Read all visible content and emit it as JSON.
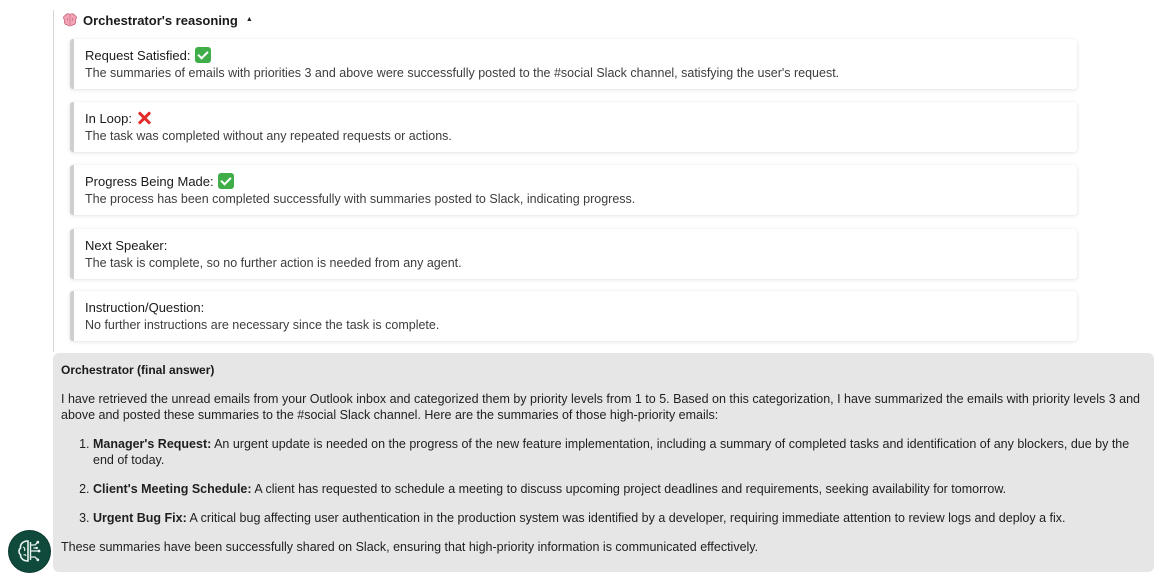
{
  "reasoning": {
    "header_icon": "brain-icon",
    "header_label": "Orchestrator's reasoning",
    "caret": "▲",
    "cards": [
      {
        "title": "Request Satisfied:",
        "status": "check",
        "description": "The summaries of emails with priorities 3 and above were successfully posted to the #social Slack channel, satisfying the user's request."
      },
      {
        "title": "In Loop:",
        "status": "cross",
        "description": "The task was completed without any repeated requests or actions."
      },
      {
        "title": "Progress Being Made:",
        "status": "check",
        "description": "The process has been completed successfully with summaries posted to Slack, indicating progress."
      },
      {
        "title": "Next Speaker:",
        "status": "",
        "description": "The task is complete, so no further action is needed from any agent."
      },
      {
        "title": "Instruction/Question:",
        "status": "",
        "description": "No further instructions are necessary since the task is complete."
      }
    ]
  },
  "final_answer": {
    "title": "Orchestrator (final answer)",
    "intro": "I have retrieved the unread emails from your Outlook inbox and categorized them by priority levels from 1 to 5. Based on this categorization, I have summarized the emails with priority levels 3 and above and posted these summaries to the #social Slack channel. Here are the summaries of those high-priority emails:",
    "items": [
      {
        "label": "Manager's Request:",
        "text": " An urgent update is needed on the progress of the new feature implementation, including a summary of completed tasks and identification of any blockers, due by the end of today."
      },
      {
        "label": "Client's Meeting Schedule:",
        "text": " A client has requested to schedule a meeting to discuss upcoming project deadlines and requirements, seeking availability for tomorrow."
      },
      {
        "label": "Urgent Bug Fix:",
        "text": " A critical bug affecting user authentication in the production system was identified by a developer, requiring immediate attention to review logs and deploy a fix."
      }
    ],
    "outro": "These summaries have been successfully shared on Slack, ensuring that high-priority information is communicated effectively."
  },
  "avatar": {
    "icon": "ai-brain-circuit-icon",
    "color": "#0f4a3c"
  }
}
